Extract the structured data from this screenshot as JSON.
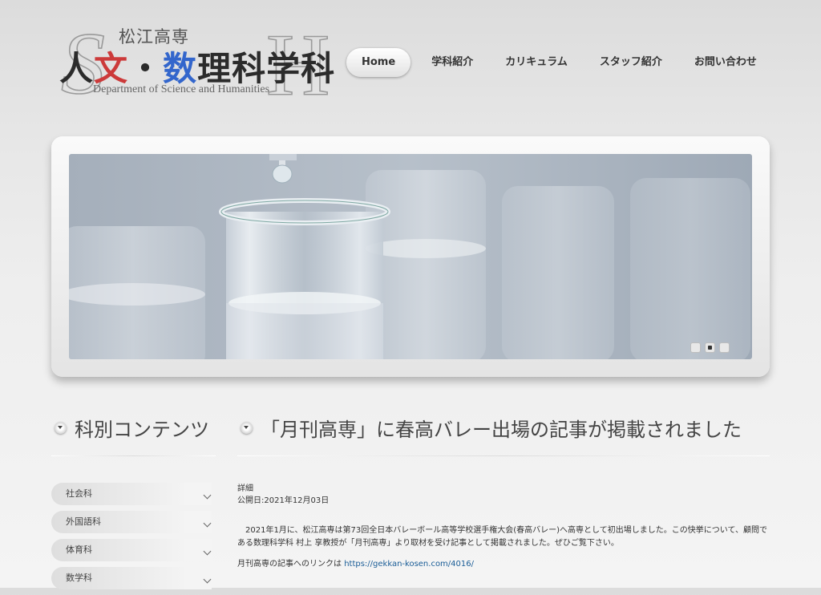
{
  "logo": {
    "top_text": "松江高専",
    "main_part1": "人",
    "main_part2": "文",
    "main_part3": "・",
    "main_part4": "数",
    "main_part5": "理科学科",
    "sub_text": "Department of Science and Humanities",
    "colors": {
      "red": "#cc3a3a",
      "blue": "#3366cc"
    }
  },
  "nav": {
    "items": [
      {
        "label": "Home",
        "active": true
      },
      {
        "label": "学科紹介"
      },
      {
        "label": "カリキュラム"
      },
      {
        "label": "スタッフ紹介"
      },
      {
        "label": "お問い合わせ"
      }
    ]
  },
  "slider": {
    "image": "test-tubes-photo",
    "slide_count": 3,
    "active_slide": 2
  },
  "sidebar": {
    "title": "科別コンテンツ",
    "items": [
      {
        "label": "社会科"
      },
      {
        "label": "外国語科"
      },
      {
        "label": "体育科"
      },
      {
        "label": "数学科"
      }
    ]
  },
  "article": {
    "title": "「月刊高専」に春高バレー出場の記事が掲載されました",
    "detail_label": "詳細",
    "published": "公開日:2021年12月03日",
    "body": "2021年1月に、松江高専は第73回全日本バレーボール高等学校選手権大会(春高バレー)へ高専として初出場しました。この快挙について、顧問である数理科学科 村上 享教授が「月刊高専」より取材を受け記事として掲載されました。ぜひご覧下さい。",
    "link_prefix": "月刊高専の記事へのリンクは",
    "link_url": "https://gekkan-kosen.com/4016/"
  }
}
